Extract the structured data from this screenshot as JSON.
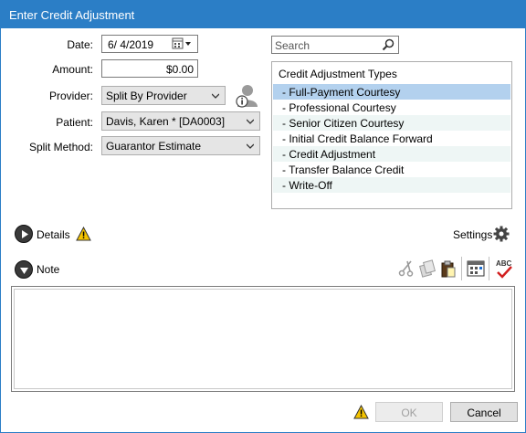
{
  "window": {
    "title": "Enter Credit Adjustment"
  },
  "form": {
    "date_label": "Date:",
    "date_value": "6/  4/2019",
    "amount_label": "Amount:",
    "amount_value": "$0.00",
    "provider_label": "Provider:",
    "provider_value": "Split By Provider",
    "patient_label": "Patient:",
    "patient_value": "Davis, Karen *  [DA0003]",
    "split_label": "Split Method:",
    "split_value": "Guarantor Estimate"
  },
  "search": {
    "placeholder": "Search"
  },
  "types": {
    "header": "Credit Adjustment Types",
    "items": [
      "- Full-Payment Courtesy",
      "- Professional Courtesy",
      "- Senior Citizen Courtesy",
      "- Initial Credit Balance Forward",
      "- Credit Adjustment",
      "- Transfer Balance Credit",
      "- Write-Off"
    ],
    "selected_index": 0
  },
  "details": {
    "label": "Details",
    "settings_label": "Settings"
  },
  "note": {
    "label": "Note",
    "text": ""
  },
  "footer": {
    "ok_label": "OK",
    "cancel_label": "Cancel"
  },
  "colors": {
    "titlebar": "#2b7ec6",
    "selection": "#b3d1ee",
    "alt_row": "#eef6f5",
    "warning": "#f5c400"
  },
  "icons": {
    "date_picker": "calendar-dropdown-icon",
    "provider_info": "person-info-icon",
    "search": "magnifier-icon",
    "details_toggle": "play-circle-icon",
    "note_toggle": "down-circle-icon",
    "warning": "warning-triangle-icon",
    "settings": "gear-icon",
    "cut": "scissors-icon",
    "copy": "copy-icon",
    "paste": "paste-icon",
    "date_stamp": "date-stamp-icon",
    "spellcheck": "spellcheck-icon"
  }
}
